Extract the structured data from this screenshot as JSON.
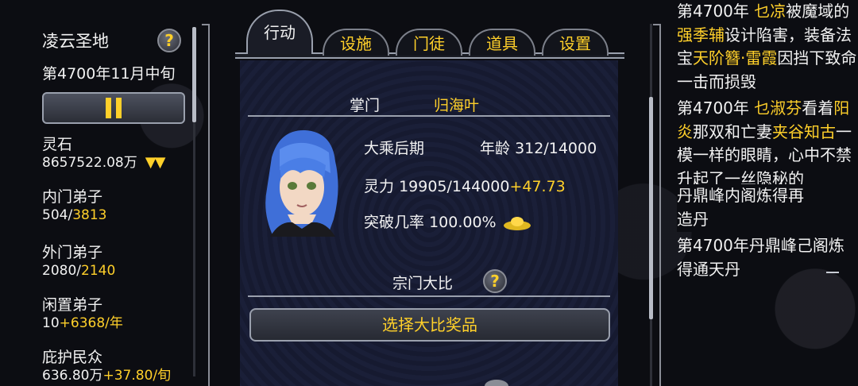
{
  "left": {
    "sect_name": "凌云圣地",
    "date": "第4700年11月中旬",
    "help": "?",
    "resources": [
      {
        "label": "灵石",
        "value": "8657522.08万",
        "extra": "",
        "arrows": "▼▼"
      },
      {
        "label": "内门弟子",
        "value": "504/",
        "extra": "3813",
        "arrows": ""
      },
      {
        "label": "外门弟子",
        "value": "2080/",
        "extra": "2140",
        "arrows": ""
      },
      {
        "label": "闲置弟子",
        "value": "10",
        "extra": "+6368/年",
        "arrows": ""
      },
      {
        "label": "庇护民众",
        "value": "636.80万",
        "extra": "+37.80/旬",
        "arrows": ""
      }
    ]
  },
  "tabs": [
    {
      "label": "行动",
      "active": true
    },
    {
      "label": "设施",
      "active": false
    },
    {
      "label": "门徒",
      "active": false
    },
    {
      "label": "道具",
      "active": false
    },
    {
      "label": "设置",
      "active": false
    }
  ],
  "master": {
    "title": "掌门",
    "name": "归海叶",
    "realm": "大乘后期",
    "age_label": "年龄",
    "age_value": "312/14000",
    "power_label": "灵力",
    "power_value": "19905/144000",
    "power_gain": "+47.73",
    "breakthrough_label": "突破几率",
    "breakthrough_value": "100.00%"
  },
  "compete": {
    "title": "宗门大比",
    "help": "?",
    "reward_button": "选择大比奖品"
  },
  "log": {
    "e1_pre": "第4700年",
    "e1_name1": "乜凉",
    "e1_mid1": "被魔域的",
    "e1_name2": "强季辅",
    "e1_mid2": "设计陷害，装备法宝",
    "e1_item": "天阶簪·雷霞",
    "e1_end": "因挡下致命一击而损毁",
    "e2_pre": "第4700年",
    "e2_name1": "乜淑芬",
    "e2_mid1": "看着",
    "e2_name2": "阳炎",
    "e2_mid2": "那双和亡妻",
    "e2_name3": "夹谷知古",
    "e2_end": "一模一样的眼睛，心中不禁升起了一丝隐秘的",
    "e3_line1": "丹鼎峰内阁炼得再",
    "e3_line2": "造丹",
    "e4": "第4700年丹鼎峰己阁炼得通天丹"
  },
  "colors": {
    "accent": "#ffd02a",
    "text": "#f2f2f2",
    "border": "#9aa0ad"
  }
}
